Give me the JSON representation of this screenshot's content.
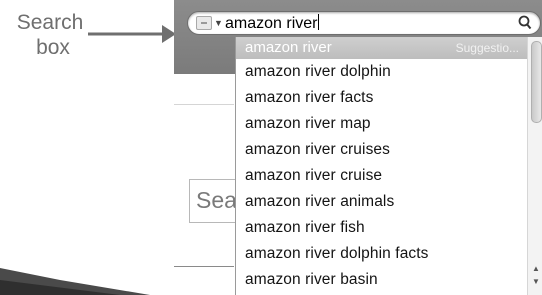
{
  "annotation": {
    "line1": "Search",
    "line2": "box"
  },
  "search": {
    "value": "amazon river",
    "engine_icon": "search-engine-icon",
    "submit_icon": "magnifier-icon"
  },
  "page": {
    "search_partial": "Sea"
  },
  "dropdown": {
    "highlighted": "amazon river",
    "highlighted_tag": "Suggestio...",
    "items": [
      "amazon river dolphin",
      "amazon river facts",
      "amazon river map",
      "amazon river cruises",
      "amazon river cruise",
      "amazon river animals",
      "amazon river fish",
      "amazon river dolphin facts",
      "amazon river basin"
    ]
  },
  "colors": {
    "chrome": "#828282",
    "annotation": "#6f6f6f",
    "highlight": "#c6c6c6"
  }
}
